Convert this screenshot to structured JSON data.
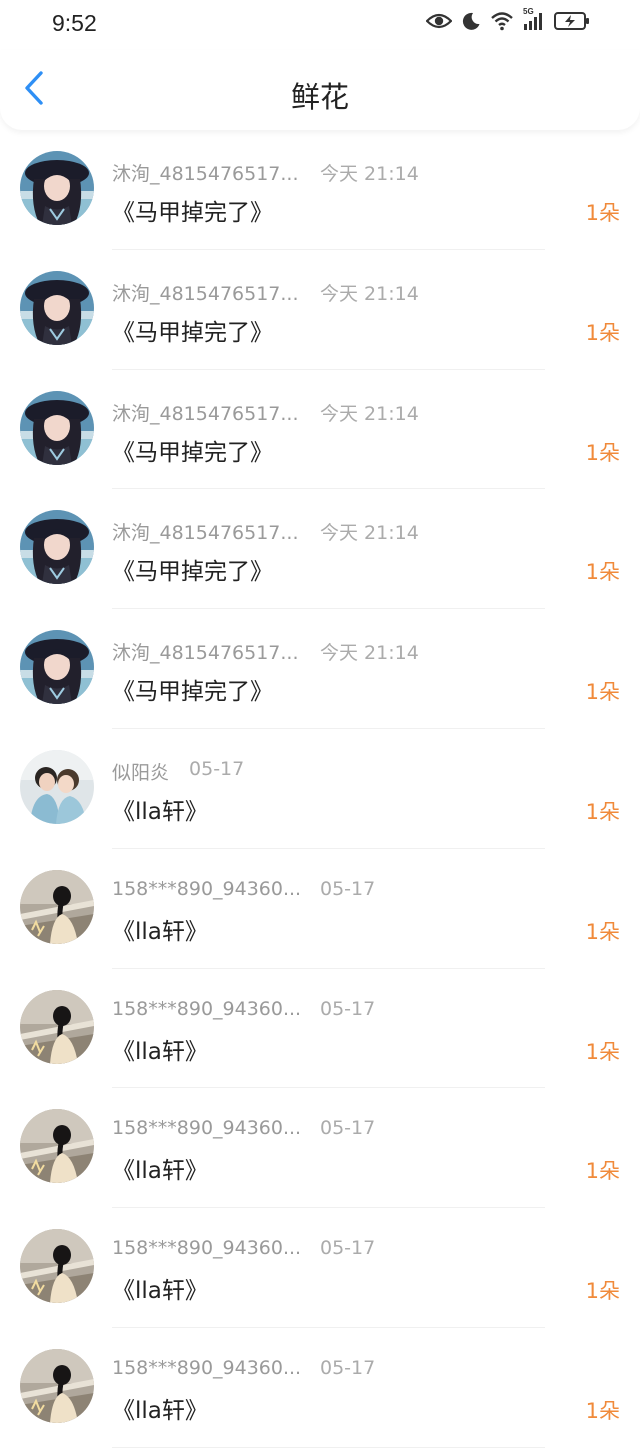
{
  "status_bar": {
    "time": "9:52",
    "network_label": "5G",
    "icons": [
      "eye-icon",
      "moon-icon",
      "wifi-icon",
      "signal-icon",
      "battery-charging-icon"
    ]
  },
  "header": {
    "title": "鲜花",
    "back_icon": "chevron-left-icon"
  },
  "colors": {
    "accent": "#2e8ff5",
    "count": "#f08a3a",
    "meta_text": "#9a9a9a",
    "primary_text": "#222222"
  },
  "rows": [
    {
      "username": "沐洵_4815476517...",
      "time": "今天 21:14",
      "title": "《马甲掉完了》",
      "count": "1朵",
      "avatar": "avatar-woman-hat"
    },
    {
      "username": "沐洵_4815476517...",
      "time": "今天 21:14",
      "title": "《马甲掉完了》",
      "count": "1朵",
      "avatar": "avatar-woman-hat"
    },
    {
      "username": "沐洵_4815476517...",
      "time": "今天 21:14",
      "title": "《马甲掉完了》",
      "count": "1朵",
      "avatar": "avatar-woman-hat"
    },
    {
      "username": "沐洵_4815476517...",
      "time": "今天 21:14",
      "title": "《马甲掉完了》",
      "count": "1朵",
      "avatar": "avatar-woman-hat"
    },
    {
      "username": "沐洵_4815476517...",
      "time": "今天 21:14",
      "title": "《马甲掉完了》",
      "count": "1朵",
      "avatar": "avatar-woman-hat"
    },
    {
      "username": "似阳炎",
      "time": "05-17",
      "title": "《lla轩》",
      "count": "1朵",
      "avatar": "avatar-couple"
    },
    {
      "username": "158***890_94360...",
      "time": "05-17",
      "title": "《lla轩》",
      "count": "1朵",
      "avatar": "avatar-girl-back"
    },
    {
      "username": "158***890_94360...",
      "time": "05-17",
      "title": "《lla轩》",
      "count": "1朵",
      "avatar": "avatar-girl-back"
    },
    {
      "username": "158***890_94360...",
      "time": "05-17",
      "title": "《lla轩》",
      "count": "1朵",
      "avatar": "avatar-girl-back"
    },
    {
      "username": "158***890_94360...",
      "time": "05-17",
      "title": "《lla轩》",
      "count": "1朵",
      "avatar": "avatar-girl-back"
    },
    {
      "username": "158***890_94360...",
      "time": "05-17",
      "title": "《lla轩》",
      "count": "1朵",
      "avatar": "avatar-girl-back"
    }
  ]
}
